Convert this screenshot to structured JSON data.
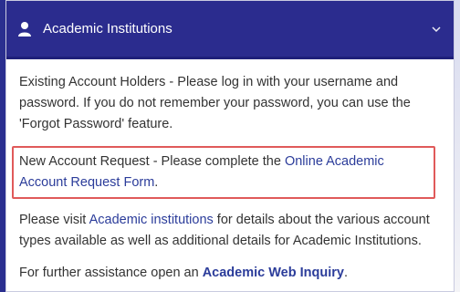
{
  "header": {
    "title": "Academic Institutions",
    "user_icon": "user-icon",
    "toggle_icon": "chevron-down-icon"
  },
  "content": {
    "p1": "Existing Account Holders - Please log in with your username and password. If you do not remember your password, you can use the 'Forgot Password' feature.",
    "p2_prefix": "New Account Request - Please complete the ",
    "p2_link": "Online Academic Account Request Form",
    "p2_suffix": ".",
    "p3_prefix": "Please visit ",
    "p3_link": "Academic institutions",
    "p3_suffix": " for details about the various account types available as well as additional details for Academic Institutions.",
    "p4_prefix": "For further assistance open an ",
    "p4_link": "Academic Web Inquiry",
    "p4_suffix": "."
  },
  "colors": {
    "header_bg": "#2b2c8e",
    "link": "#2b3c9a",
    "highlight_border": "#e05a5a"
  }
}
